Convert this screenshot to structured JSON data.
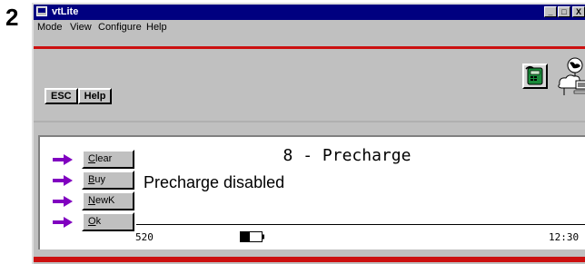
{
  "step_number": "2",
  "window": {
    "title": "vtLite",
    "controls": {
      "minimize": "_",
      "maximize": "□",
      "close": "X"
    }
  },
  "menu": [
    "Mode",
    "View",
    "Configure",
    "Help"
  ],
  "toolbar": {
    "esc_label": "ESC",
    "help_label": "Help"
  },
  "icons": {
    "phone": "phone-icon",
    "network": "network-icon",
    "app": "app-icon"
  },
  "softkeys": [
    {
      "mnemonic": "C",
      "rest": "lear"
    },
    {
      "mnemonic": "B",
      "rest": "uy"
    },
    {
      "mnemonic": "N",
      "rest": "ewK"
    },
    {
      "mnemonic": "O",
      "rest": "k"
    }
  ],
  "screen": {
    "heading": "8 - Precharge",
    "message": "Precharge disabled"
  },
  "status": {
    "left": "520",
    "right": "12:30"
  },
  "colors": {
    "titlebar": "#000080",
    "accent_red": "#cc1010",
    "arrow": "#8000c0"
  }
}
